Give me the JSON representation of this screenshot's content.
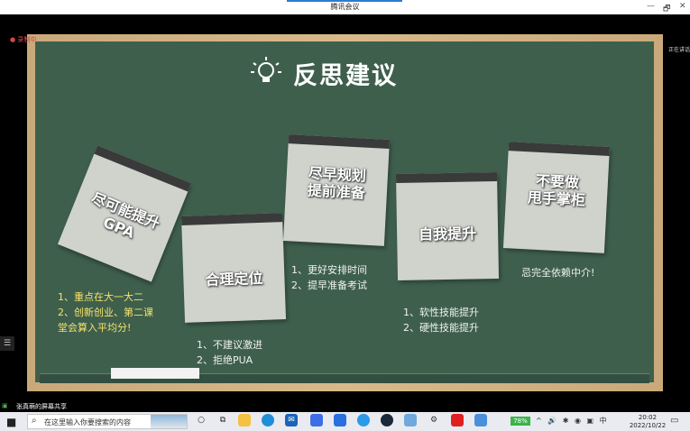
{
  "window": {
    "title": "腾讯会议",
    "controls": [
      "—",
      "🗗",
      "✕"
    ]
  },
  "meeting": {
    "recording_label": "录制中",
    "speaking_label": "正在讲话",
    "share_label": "张真萌的屏幕共享"
  },
  "slide": {
    "title": "反思建议",
    "cards": [
      {
        "label": "尽可能提升GPA"
      },
      {
        "label": "合理定位"
      },
      {
        "label_line1": "尽早规划",
        "label_line2": "提前准备"
      },
      {
        "label": "自我提升"
      },
      {
        "label_line1": "不要做",
        "label_line2": "甩手掌柜"
      }
    ],
    "notes": {
      "gpa": [
        "1、重点在大一大二",
        "2、创新创业、第二课",
        "堂会算入平均分!"
      ],
      "position": [
        "1、不建议激进",
        "2、拒绝PUA"
      ],
      "plan": [
        "1、更好安排时间",
        "2、提早准备考试"
      ],
      "self": [
        "1、软性技能提升",
        "2、硬性技能提升"
      ],
      "agent": [
        "忌完全依赖中介!"
      ]
    }
  },
  "taskbar": {
    "search_placeholder": "在这里输入你要搜索的内容",
    "battery": "78%",
    "time": "20:02",
    "date": "2022/10/22"
  }
}
